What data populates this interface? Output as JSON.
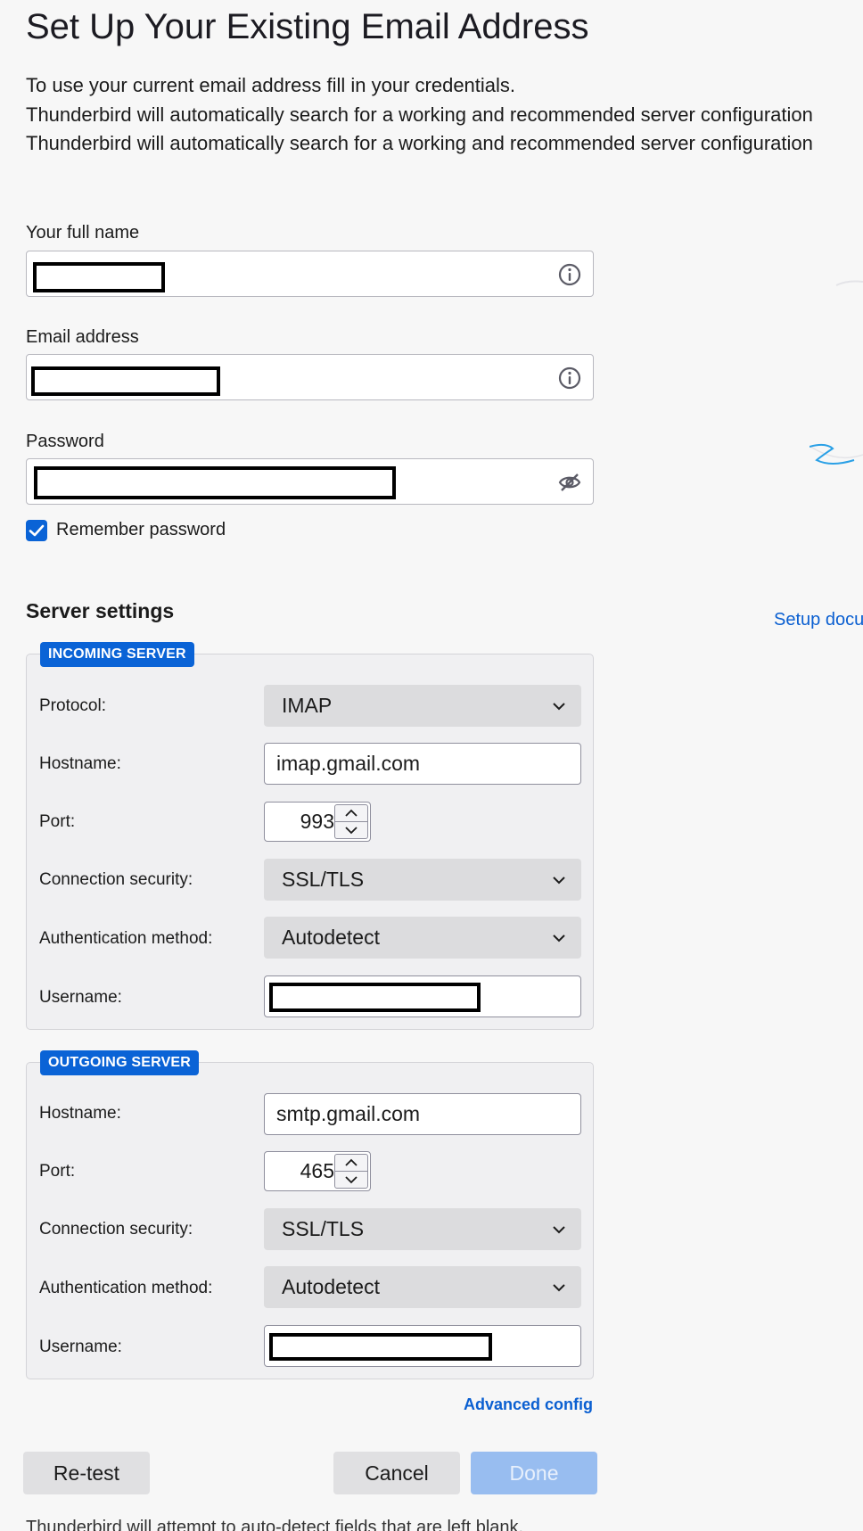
{
  "header": {
    "title": "Set Up Your Existing Email Address",
    "intro_line1": "To use your current email address fill in your credentials.",
    "intro_line2": "Thunderbird will automatically search for a working and recommended server configuration",
    "intro_line3": "Thunderbird will automatically search for a working and recommended server configuration"
  },
  "form": {
    "full_name_label": "Your full name",
    "email_label": "Email address",
    "password_label": "Password",
    "remember_password_label": "Remember password",
    "remember_password_checked": true
  },
  "server_settings": {
    "title": "Server settings",
    "setup_doc_link": "Setup docu",
    "incoming": {
      "legend": "INCOMING SERVER",
      "protocol_label": "Protocol:",
      "protocol_value": "IMAP",
      "hostname_label": "Hostname:",
      "hostname_value": "imap.gmail.com",
      "port_label": "Port:",
      "port_value": "993",
      "security_label": "Connection security:",
      "security_value": "SSL/TLS",
      "auth_label": "Authentication method:",
      "auth_value": "Autodetect",
      "username_label": "Username:"
    },
    "outgoing": {
      "legend": "OUTGOING SERVER",
      "hostname_label": "Hostname:",
      "hostname_value": "smtp.gmail.com",
      "port_label": "Port:",
      "port_value": "465",
      "security_label": "Connection security:",
      "security_value": "SSL/TLS",
      "auth_label": "Authentication method:",
      "auth_value": "Autodetect",
      "username_label": "Username:"
    },
    "advanced_config_link": "Advanced config"
  },
  "buttons": {
    "retest": "Re-test",
    "cancel": "Cancel",
    "done": "Done"
  },
  "footnote": "Thunderbird will attempt to auto-detect fields that are left blank.",
  "colors": {
    "accent": "#0a63d6",
    "link": "#0a5fd1",
    "done_disabled": "#98bdf0"
  },
  "icons": {
    "full_name": "info-icon",
    "email": "info-icon",
    "password": "eye-slash-icon",
    "select": "chevron-down-icon"
  }
}
